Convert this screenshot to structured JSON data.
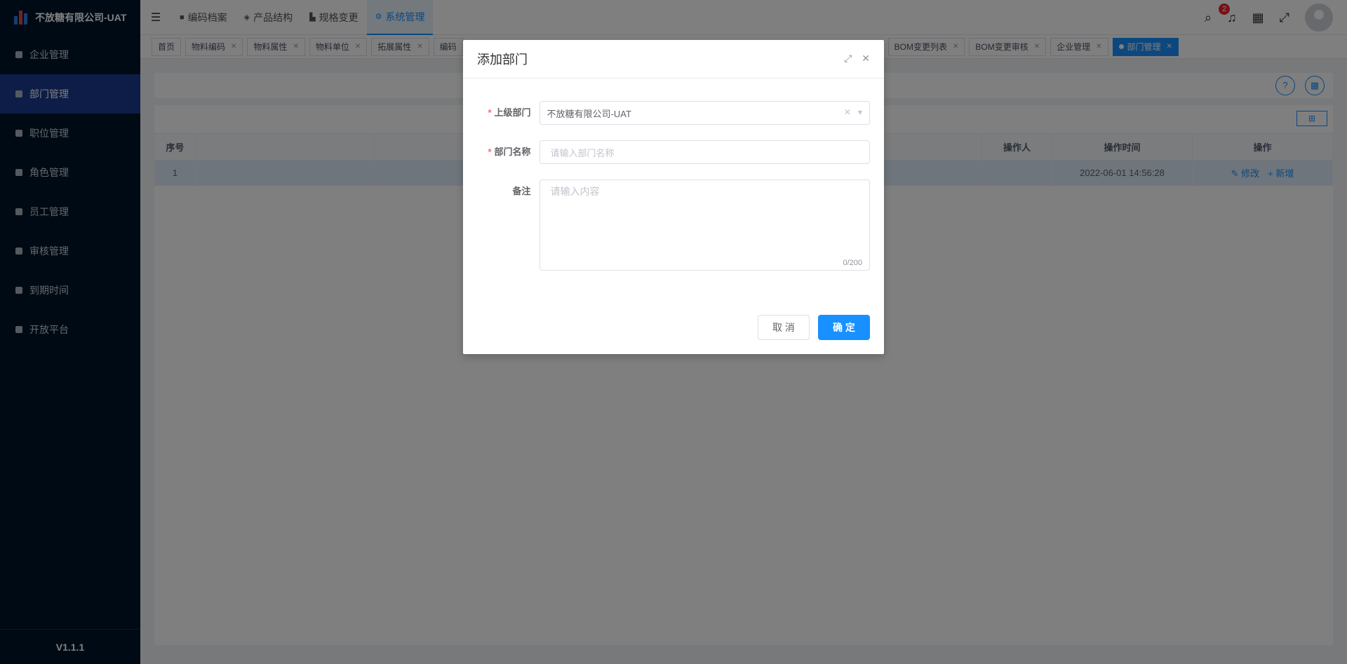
{
  "app": {
    "title": "不放糖有限公司-UAT",
    "version": "V1.1.1"
  },
  "sidebar": {
    "items": [
      {
        "label": "企业管理",
        "icon": "building-icon"
      },
      {
        "label": "部门管理",
        "icon": "org-tree-icon",
        "active": true
      },
      {
        "label": "职位管理",
        "icon": "id-card-icon"
      },
      {
        "label": "角色管理",
        "icon": "role-icon"
      },
      {
        "label": "员工管理",
        "icon": "user-icon"
      },
      {
        "label": "审核管理",
        "icon": "check-square-icon"
      },
      {
        "label": "到期时间",
        "icon": "calendar-icon"
      },
      {
        "label": "开放平台",
        "icon": "platform-icon"
      }
    ]
  },
  "topnav": {
    "items": [
      {
        "label": "编码档案",
        "icon": "folder-icon"
      },
      {
        "label": "产品结构",
        "icon": "layers-icon"
      },
      {
        "label": "规格变更",
        "icon": "spec-icon"
      },
      {
        "label": "系统管理",
        "icon": "gear-icon",
        "active": true
      }
    ],
    "notification_count": "2"
  },
  "tabs": [
    {
      "label": "首页",
      "closable": false
    },
    {
      "label": "物料编码"
    },
    {
      "label": "物料属性"
    },
    {
      "label": "物料单位"
    },
    {
      "label": "拓展属性"
    },
    {
      "label": "编码"
    },
    {
      "label": "BOM变更列表"
    },
    {
      "label": "BOM变更审核"
    },
    {
      "label": "企业管理"
    },
    {
      "label": "部门管理",
      "active": true
    }
  ],
  "table": {
    "headers": [
      "序号",
      "",
      "",
      "操作人",
      "操作时间",
      "操作"
    ],
    "rows": [
      {
        "index": "1",
        "operator": "",
        "time": "2022-06-01 14:56:28",
        "edit": "修改",
        "add": "新增"
      }
    ]
  },
  "dialog": {
    "title": "添加部门",
    "parent_label": "上级部门",
    "parent_value": "不放糖有限公司-UAT",
    "name_label": "部门名称",
    "name_placeholder": "请输入部门名称",
    "remark_label": "备注",
    "remark_placeholder": "请输入内容",
    "remark_counter": "0/200",
    "cancel": "取 消",
    "ok": "确 定"
  },
  "colors": {
    "primary": "#1890ff",
    "sidebar": "#001529",
    "active_nav": "#1a3a8f"
  }
}
